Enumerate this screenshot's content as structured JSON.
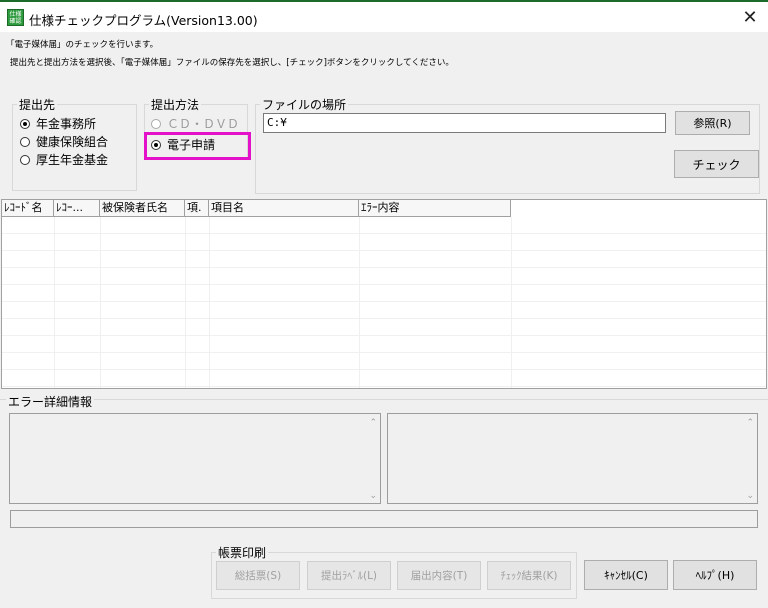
{
  "window": {
    "title": "仕様チェックプログラム(Version13.00)",
    "icon_text": "仕様\n確認",
    "close_glyph": "✕"
  },
  "messages": {
    "line1": "「電子媒体届」のチェックを行います。",
    "line2": "提出先と提出方法を選択後、「電子媒体届」ファイルの保存先を選択し、[チェック]ボタンをクリックしてください。"
  },
  "destination": {
    "legend": "提出先",
    "options": [
      {
        "label": "年金事務所",
        "selected": true
      },
      {
        "label": "健康保険組合",
        "selected": false
      },
      {
        "label": "厚生年金基金",
        "selected": false
      }
    ]
  },
  "method": {
    "legend": "提出方法",
    "options": [
      {
        "label": "ＣＤ・ＤＶＤ",
        "selected": false,
        "enabled": false
      },
      {
        "label": "電子申請",
        "selected": true,
        "enabled": true
      }
    ],
    "highlight_color": "#e312c8"
  },
  "file_location": {
    "legend": "ファイルの場所",
    "value": "C:¥",
    "browse_label": "参照(R)"
  },
  "check_button": "チェック",
  "grid": {
    "columns": [
      "ﾚｺｰﾄﾞ名",
      "ﾚｺｰ...",
      "被保険者氏名",
      "項.",
      "項目名",
      "ｴﾗｰ内容"
    ]
  },
  "error_detail": {
    "legend": "エラー詳細情報"
  },
  "print_group": {
    "legend": "帳票印刷",
    "buttons": [
      "総括票(S)",
      "提出ﾗﾍﾞﾙ(L)",
      "届出内容(T)",
      "ﾁｪｯｸ結果(K)"
    ]
  },
  "footer_buttons": {
    "cancel": "ｷｬﾝｾﾙ(C)",
    "help": "ﾍﾙﾌﾟ(H)"
  }
}
